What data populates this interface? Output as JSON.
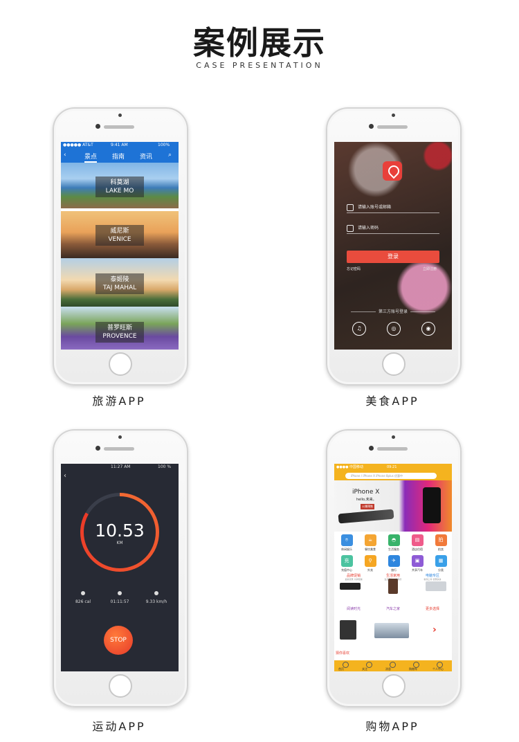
{
  "header": {
    "title": "案例展示",
    "subtitle": "CASE PRESENTATION"
  },
  "cases": [
    {
      "label": "旅游APP"
    },
    {
      "label": "美食APP"
    },
    {
      "label": "运动APP"
    },
    {
      "label": "购物APP"
    }
  ],
  "travel": {
    "status": {
      "carrier": "●●●●● AT&T",
      "time": "9:41 AM",
      "battery": "100%"
    },
    "tabs": [
      "景点",
      "指南",
      "资讯"
    ],
    "cards": [
      {
        "cn": "科莫湖",
        "en": "LAKE MO"
      },
      {
        "cn": "威尼斯",
        "en": "VENICE"
      },
      {
        "cn": "泰姬陵",
        "en": "TAJ MAHAL"
      },
      {
        "cn": "普罗旺斯",
        "en": "PROVENCE"
      }
    ]
  },
  "food": {
    "username_placeholder": "请输入账号或邮箱",
    "password_placeholder": "请输入密码",
    "login": "登录",
    "forgot": "忘记密码",
    "register": "立即注册",
    "third_party": "第三方账号登录"
  },
  "sport": {
    "status": {
      "time": "11:27 AM",
      "battery": "100 %"
    },
    "distance": "10.53",
    "unit": "KM",
    "progress_fraction": 0.83,
    "stats": [
      {
        "value": "826 cal"
      },
      {
        "value": "01:11:57"
      },
      {
        "value": "9.33 km/h"
      }
    ],
    "stop": "STOP"
  },
  "shop": {
    "status": {
      "carrier": "●●●● 中国移动",
      "time": "09:21"
    },
    "search": "iPhone / iPhone X iPhone 8plus 优惠中",
    "banner": {
      "title": "iPhone X",
      "tagline": "hello,未来。",
      "badge": "火爆预售"
    },
    "categories": [
      {
        "label": "休闲娱乐",
        "icon": "⌾",
        "color": "#3b8fe0"
      },
      {
        "label": "餐饮美食",
        "icon": "☕",
        "color": "#f4a533"
      },
      {
        "label": "生活服务",
        "icon": "◓",
        "color": "#38b36a"
      },
      {
        "label": "酒店住宿",
        "icon": "▤",
        "color": "#ef5b8a"
      },
      {
        "label": "拍卖",
        "icon": "拍",
        "color": "#f17a3a"
      },
      {
        "label": "充值中心",
        "icon": "充",
        "color": "#4cc3a0"
      },
      {
        "label": "外卖",
        "icon": "⚲",
        "color": "#f5a623"
      },
      {
        "label": "旅行",
        "icon": "✈",
        "color": "#2e86de"
      },
      {
        "label": "共享汽车",
        "icon": "▣",
        "color": "#8e5bd6"
      },
      {
        "label": "分类",
        "icon": "▦",
        "color": "#3aa0e8"
      }
    ],
    "sections": [
      {
        "label": "品牌促销",
        "sub": "最新优惠 大牌促销",
        "color": "#e63b2e"
      },
      {
        "label": "生活家用",
        "sub": "生活家电 一站购齐",
        "color": "#e63b2e"
      },
      {
        "label": "电脑专区",
        "sub": "新款上市 优惠多多",
        "color": "#2e86de"
      },
      {
        "label": "阅读时光",
        "sub": "",
        "color": "#8e44ad"
      },
      {
        "label": "汽车之家",
        "sub": "",
        "color": "#8e44ad"
      },
      {
        "label": "更多选择",
        "sub": "",
        "color": "#e63b2e"
      }
    ],
    "guess": "猜你喜欢",
    "tabs": [
      "首页",
      "关注",
      "消息",
      "购物车",
      "个人中心"
    ]
  }
}
